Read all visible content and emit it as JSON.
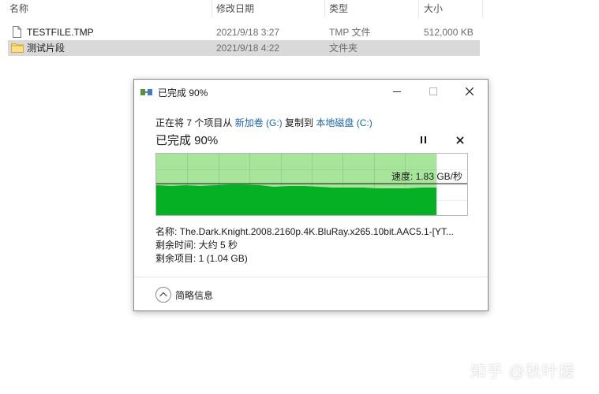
{
  "explorer": {
    "columns": [
      "名称",
      "修改日期",
      "类型",
      "大小"
    ],
    "files": [
      {
        "name": "TESTFILE.TMP",
        "date": "2021/9/18 3:27",
        "type": "TMP 文件",
        "size": "512,000 KB",
        "icon": "file-icon",
        "selected": false
      },
      {
        "name": "测试片段",
        "date": "2021/9/18 4:22",
        "type": "文件夹",
        "size": "",
        "icon": "folder-icon",
        "selected": true
      }
    ]
  },
  "dialog": {
    "title": "已完成 90%",
    "line_prefix": "正在将 7 个项目从",
    "source": "新加卷 (G:)",
    "line_mid": "复制到",
    "dest": "本地磁盘 (C:)",
    "progress_label": "已完成 90%",
    "progress": 0.9,
    "speed": "速度: 1.83 GB/秒",
    "name_line": "名称: The.Dark.Knight.2008.2160p.4K.BluRay.x265.10bit.AAC5.1-[YT...",
    "time_line": "剩余时间: 大约 5 秒",
    "items_line": "剩余项目: 1 (1.04 GB)",
    "more_info": "简略信息"
  },
  "colors": {
    "progress_bg": "#a7e59b",
    "throughput_fill": "#06b025",
    "link": "#1a64b4"
  },
  "watermark": "知乎 @秋叶援"
}
